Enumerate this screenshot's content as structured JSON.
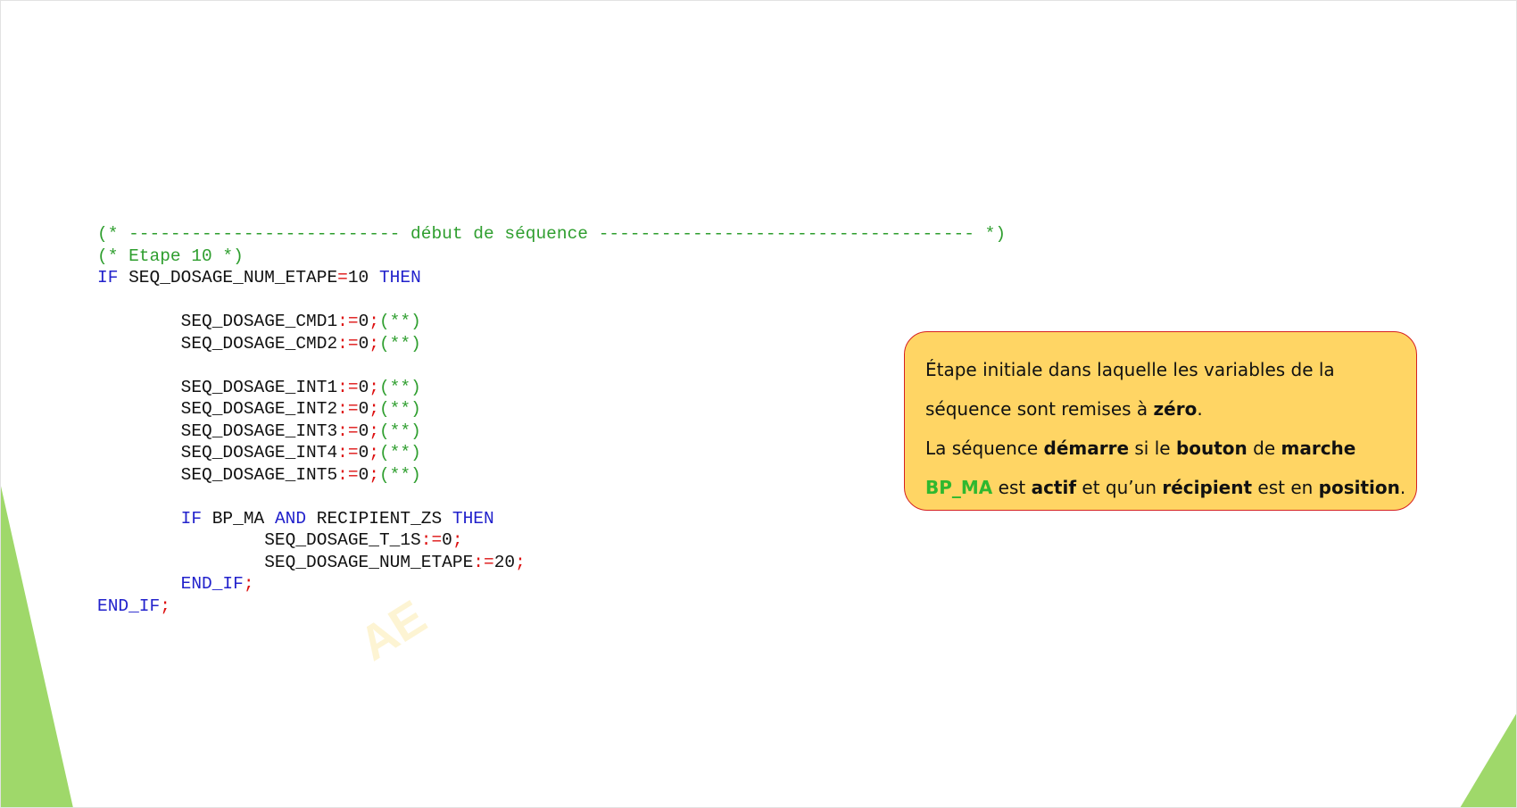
{
  "code": {
    "line1": [
      {
        "text": "(* -------------------------- début de séquence ------------------------------------ *)",
        "cls": "cm"
      }
    ],
    "line2": [
      {
        "text": "(* Etape 10 *)",
        "cls": "cm"
      }
    ],
    "line3": [
      {
        "text": "IF",
        "cls": "kw"
      },
      {
        "text": " SEQ_DOSAGE_NUM_ETAPE",
        "cls": "id"
      },
      {
        "text": "=",
        "cls": "op"
      },
      {
        "text": "10 ",
        "cls": "id"
      },
      {
        "text": "THEN",
        "cls": "kw"
      }
    ],
    "line4": [],
    "line5": [
      {
        "text": "        SEQ_DOSAGE_CMD1",
        "cls": "id"
      },
      {
        "text": ":=",
        "cls": "op"
      },
      {
        "text": "0",
        "cls": "id"
      },
      {
        "text": ";",
        "cls": "op"
      },
      {
        "text": "(**)",
        "cls": "cm"
      }
    ],
    "line6": [
      {
        "text": "        SEQ_DOSAGE_CMD2",
        "cls": "id"
      },
      {
        "text": ":=",
        "cls": "op"
      },
      {
        "text": "0",
        "cls": "id"
      },
      {
        "text": ";",
        "cls": "op"
      },
      {
        "text": "(**)",
        "cls": "cm"
      }
    ],
    "line7": [],
    "line8": [
      {
        "text": "        SEQ_DOSAGE_INT1",
        "cls": "id"
      },
      {
        "text": ":=",
        "cls": "op"
      },
      {
        "text": "0",
        "cls": "id"
      },
      {
        "text": ";",
        "cls": "op"
      },
      {
        "text": "(**)",
        "cls": "cm"
      }
    ],
    "line9": [
      {
        "text": "        SEQ_DOSAGE_INT2",
        "cls": "id"
      },
      {
        "text": ":=",
        "cls": "op"
      },
      {
        "text": "0",
        "cls": "id"
      },
      {
        "text": ";",
        "cls": "op"
      },
      {
        "text": "(**)",
        "cls": "cm"
      }
    ],
    "line10": [
      {
        "text": "        SEQ_DOSAGE_INT3",
        "cls": "id"
      },
      {
        "text": ":=",
        "cls": "op"
      },
      {
        "text": "0",
        "cls": "id"
      },
      {
        "text": ";",
        "cls": "op"
      },
      {
        "text": "(**)",
        "cls": "cm"
      }
    ],
    "line11": [
      {
        "text": "        SEQ_DOSAGE_INT4",
        "cls": "id"
      },
      {
        "text": ":=",
        "cls": "op"
      },
      {
        "text": "0",
        "cls": "id"
      },
      {
        "text": ";",
        "cls": "op"
      },
      {
        "text": "(**)",
        "cls": "cm"
      }
    ],
    "line12": [
      {
        "text": "        SEQ_DOSAGE_INT5",
        "cls": "id"
      },
      {
        "text": ":=",
        "cls": "op"
      },
      {
        "text": "0",
        "cls": "id"
      },
      {
        "text": ";",
        "cls": "op"
      },
      {
        "text": "(**)",
        "cls": "cm"
      }
    ],
    "line13": [],
    "line14": [
      {
        "text": "        IF",
        "cls": "kw"
      },
      {
        "text": " BP_MA ",
        "cls": "id"
      },
      {
        "text": "AND",
        "cls": "kw"
      },
      {
        "text": " RECIPIENT_ZS ",
        "cls": "id"
      },
      {
        "text": "THEN",
        "cls": "kw"
      }
    ],
    "line15": [
      {
        "text": "                SEQ_DOSAGE_T_1S",
        "cls": "id"
      },
      {
        "text": ":=",
        "cls": "op"
      },
      {
        "text": "0",
        "cls": "id"
      },
      {
        "text": ";",
        "cls": "op"
      }
    ],
    "line16": [
      {
        "text": "                SEQ_DOSAGE_NUM_ETAPE",
        "cls": "id"
      },
      {
        "text": ":=",
        "cls": "op"
      },
      {
        "text": "20",
        "cls": "id"
      },
      {
        "text": ";",
        "cls": "op"
      }
    ],
    "line17": [
      {
        "text": "        END_IF",
        "cls": "kw"
      },
      {
        "text": ";",
        "cls": "op"
      }
    ],
    "line18": [
      {
        "text": "END_IF",
        "cls": "kw"
      },
      {
        "text": ";",
        "cls": "op"
      }
    ]
  },
  "watermark": "AE",
  "note": {
    "p1_a": "Étape initiale dans laquelle les variables de la séquence sont remises à ",
    "p1_b": "zéro",
    "p1_c": ".",
    "p2_a": "La séquence ",
    "p2_b": "démarre",
    "p2_c": " si le ",
    "p2_d": "bouton",
    "p2_e": " de ",
    "p2_f": "marche",
    "p3_a": "BP_MA",
    "p3_b": " est ",
    "p3_c": "actif",
    "p3_d": " et qu’un ",
    "p3_e": "récipient",
    "p3_f": " est en ",
    "p3_g": "position",
    "p3_h": "."
  },
  "colors": {
    "accent_green": "#9fd86a",
    "note_fill": "#ffd564",
    "note_border": "#d62020",
    "code_comment": "#2e9e2e",
    "code_keyword": "#2222cc",
    "code_operator": "#dd1111"
  }
}
